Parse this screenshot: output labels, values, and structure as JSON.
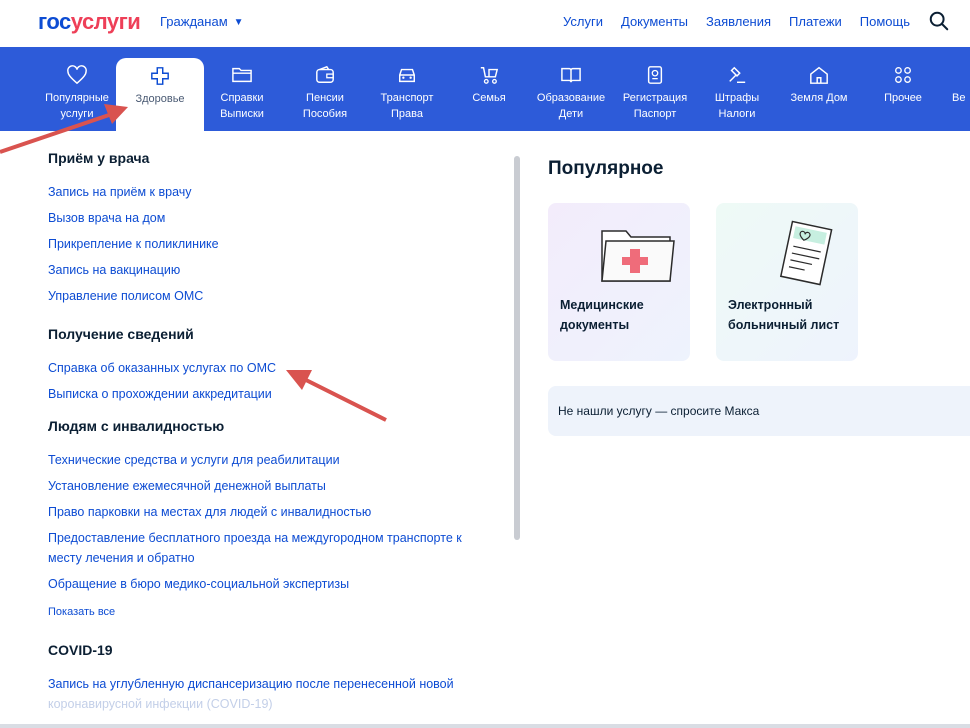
{
  "header": {
    "logo_part1": "гос",
    "logo_part2": "услуги",
    "audience": "Гражданам",
    "nav": [
      "Услуги",
      "Документы",
      "Заявления",
      "Платежи",
      "Помощь"
    ]
  },
  "categories": [
    {
      "l1": "Популярные",
      "l2": "услуги",
      "icon": "heart-icon"
    },
    {
      "l1": "Здоровье",
      "l2": "",
      "icon": "medical-cross-icon"
    },
    {
      "l1": "Справки",
      "l2": "Выписки",
      "icon": "folder-icon"
    },
    {
      "l1": "Пенсии",
      "l2": "Пособия",
      "icon": "wallet-icon"
    },
    {
      "l1": "Транспорт",
      "l2": "Права",
      "icon": "car-icon"
    },
    {
      "l1": "Семья",
      "l2": "",
      "icon": "stroller-icon"
    },
    {
      "l1": "Образование",
      "l2": "Дети",
      "icon": "book-icon"
    },
    {
      "l1": "Регистрация",
      "l2": "Паспорт",
      "icon": "passport-icon"
    },
    {
      "l1": "Штрафы",
      "l2": "Налоги",
      "icon": "gavel-icon"
    },
    {
      "l1": "Земля Дом",
      "l2": "",
      "icon": "house-icon"
    },
    {
      "l1": "Прочее",
      "l2": "",
      "icon": "grid-icon"
    },
    {
      "l1": "Ве",
      "l2": "",
      "icon": ""
    }
  ],
  "sections": [
    {
      "title": "Приём у врача",
      "links": [
        "Запись на приём к врачу",
        "Вызов врача на дом",
        "Прикрепление к поликлинике",
        "Запись на вакцинацию",
        "Управление полисом ОМС"
      ]
    },
    {
      "title": "Получение сведений",
      "links": [
        "Справка об оказанных услугах по ОМС",
        "Выписка о прохождении аккредитации"
      ]
    },
    {
      "title": "Людям с инвалидностью",
      "links": [
        "Технические средства и услуги для реабилитации",
        "Установление ежемесячной денежной выплаты",
        "Право парковки на местах для людей с инвалидностью",
        "Предоставление бесплатного проезда на междугородном транспорте к месту лечения и обратно",
        "Обращение в бюро медико-социальной экспертизы"
      ]
    },
    {
      "title": "COVID-19",
      "links": [
        "Запись на углубленную диспансеризацию после перенесенной новой",
        "коронавирусной инфекции (COVID-19)"
      ]
    }
  ],
  "show_all": "Показать все",
  "popular": {
    "title": "Популярное",
    "cards": [
      "Медицинские документы",
      "Электронный больничный лист"
    ]
  },
  "ask": "Не нашли услугу — спросите Макса",
  "colors": {
    "primary": "#0d4cd3",
    "catbar": "#2d5bd9",
    "red": "#ee3f58",
    "arrow": "#d9534f"
  }
}
